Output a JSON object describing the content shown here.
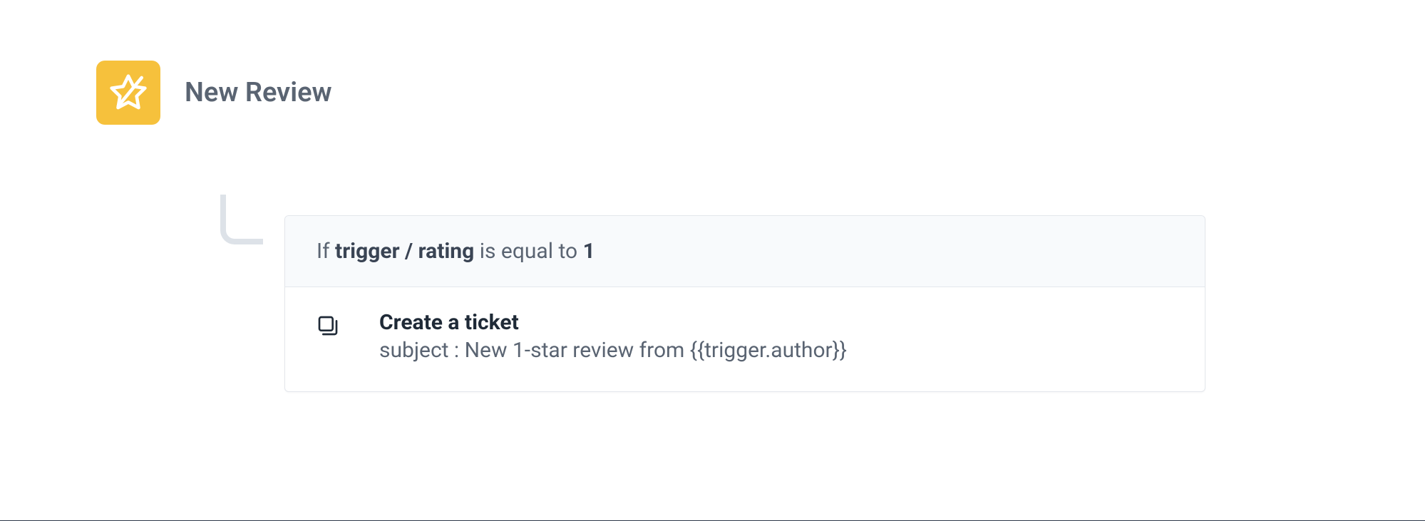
{
  "trigger": {
    "title": "New Review"
  },
  "condition": {
    "prefix": "If",
    "field_group": "trigger",
    "slash": "/",
    "field_name": "rating",
    "operator": "is equal to",
    "value": "1"
  },
  "action": {
    "title": "Create a ticket",
    "detail_label": "subject :",
    "detail_value": "New 1-star review from {{trigger.author}}"
  }
}
